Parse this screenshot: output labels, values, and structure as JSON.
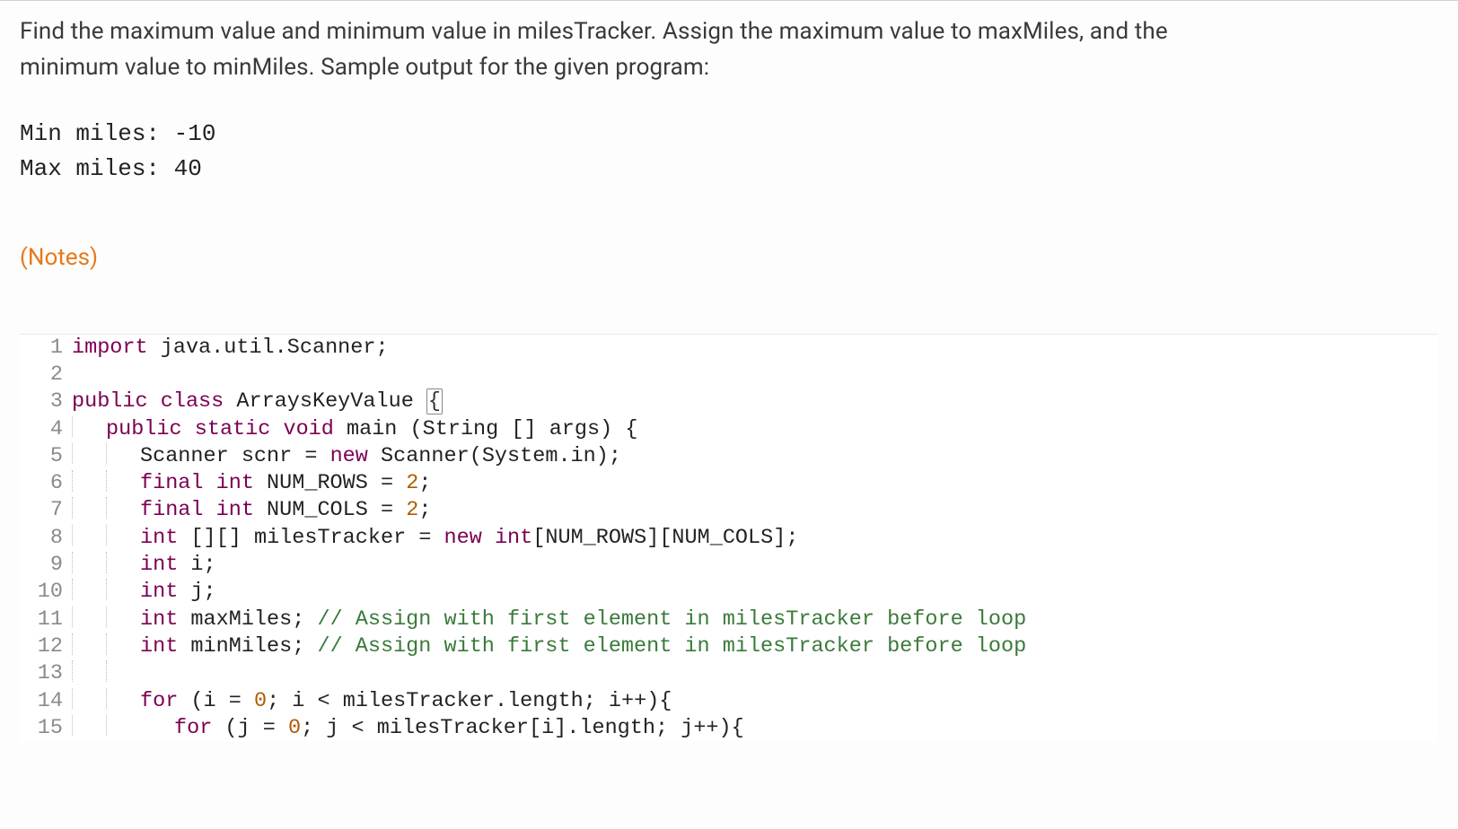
{
  "prompt": {
    "line1": "Find the maximum value and minimum value in milesTracker. Assign the maximum value to maxMiles, and the",
    "line2": "minimum value to minMiles. Sample output for the given program:"
  },
  "sample_output": {
    "line1": "Min miles: -10",
    "line2": "Max miles: 40"
  },
  "notes_label": "(Notes)",
  "code_lines": {
    "l1": {
      "num": "1"
    },
    "l2": {
      "num": "2"
    },
    "l3": {
      "num": "3"
    },
    "l4": {
      "num": "4"
    },
    "l5": {
      "num": "5"
    },
    "l6": {
      "num": "6"
    },
    "l7": {
      "num": "7"
    },
    "l8": {
      "num": "8"
    },
    "l9": {
      "num": "9"
    },
    "l10": {
      "num": "10"
    },
    "l11": {
      "num": "11"
    },
    "l12": {
      "num": "12"
    },
    "l13": {
      "num": "13"
    },
    "l14": {
      "num": "14"
    },
    "l15": {
      "num": "15"
    }
  },
  "tokens": {
    "import": "import",
    "java_util_scanner": "java.util.Scanner",
    "semi": ";",
    "public": "public",
    "class": "class",
    "ArraysKeyValue": "ArraysKeyValue",
    "lbrace": "{",
    "rbrace": "}",
    "static": "static",
    "void": "void",
    "main": "main",
    "lparen": "(",
    "rparen": ")",
    "String": "String",
    "brackets": "[]",
    "args": "args",
    "Scanner": "Scanner",
    "scnr": "scnr",
    "eq": "=",
    "new": "new",
    "System_in": "System.in",
    "final": "final",
    "int": "int",
    "NUM_ROWS": "NUM_ROWS",
    "NUM_COLS": "NUM_COLS",
    "two": "2",
    "milesTracker": "milesTracker",
    "lbrack": "[",
    "rbrack": "]",
    "i": "i",
    "j": "j",
    "maxMiles": "maxMiles",
    "minMiles": "minMiles",
    "comment_max": "// Assign with first element in milesTracker before loop",
    "comment_min": "// Assign with first element in milesTracker before loop",
    "for": "for",
    "zero": "0",
    "lt": "<",
    "dot_length": ".length",
    "ipp": "i++",
    "jpp": "j++",
    "milesTracker_i_length": "milesTracker[i].length",
    "milesTracker_length": "milesTracker.length"
  }
}
